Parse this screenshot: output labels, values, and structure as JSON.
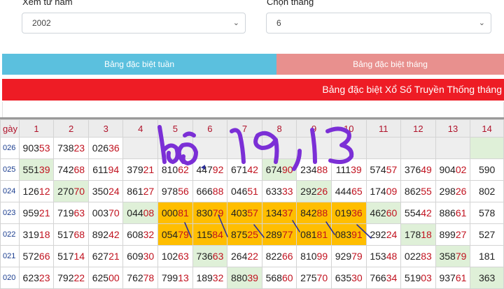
{
  "filters": {
    "year_label": "Xem từ năm",
    "year_value": "2002",
    "month_label": "Chọn tháng",
    "month_value": "6"
  },
  "tabs": {
    "weekly": "Bảng đặc biệt tuần",
    "monthly": "Bảng đặc biệt tháng"
  },
  "banner": "Bảng đặc biệt Xổ Số Truyền Thống tháng",
  "table": {
    "corner": "gày",
    "days": [
      "1",
      "2",
      "3",
      "4",
      "5",
      "6",
      "7",
      "8",
      "9",
      "10",
      "11",
      "12",
      "13",
      "14"
    ],
    "rows": [
      {
        "label": "026",
        "cells": [
          [
            "903",
            "53"
          ],
          [
            "738",
            "23"
          ],
          [
            "026",
            "36"
          ],
          [
            "",
            ""
          ],
          [
            "",
            ""
          ],
          [
            "",
            ""
          ],
          [
            "",
            ""
          ],
          [
            "",
            ""
          ],
          [
            "",
            ""
          ],
          [
            "",
            ""
          ],
          [
            "",
            ""
          ],
          [
            "",
            ""
          ],
          [
            "",
            ""
          ],
          [
            "",
            ""
          ]
        ]
      },
      {
        "label": "025",
        "cells": [
          [
            "551",
            "39"
          ],
          [
            "742",
            "68"
          ],
          [
            "611",
            "94"
          ],
          [
            "379",
            "21"
          ],
          [
            "810",
            "62"
          ],
          [
            "447",
            "92"
          ],
          [
            "671",
            "42"
          ],
          [
            "674",
            "90"
          ],
          [
            "234",
            "88"
          ],
          [
            "111",
            "39"
          ],
          [
            "574",
            "57"
          ],
          [
            "376",
            "49"
          ],
          [
            "904",
            "02"
          ],
          [
            "590",
            ""
          ]
        ]
      },
      {
        "label": "024",
        "cells": [
          [
            "126",
            "12"
          ],
          [
            "270",
            "70"
          ],
          [
            "350",
            "24"
          ],
          [
            "861",
            "27"
          ],
          [
            "978",
            "56"
          ],
          [
            "666",
            "88"
          ],
          [
            "046",
            "51"
          ],
          [
            "633",
            "33"
          ],
          [
            "292",
            "26"
          ],
          [
            "444",
            "65"
          ],
          [
            "174",
            "09"
          ],
          [
            "862",
            "55"
          ],
          [
            "298",
            "26"
          ],
          [
            "802",
            ""
          ]
        ]
      },
      {
        "label": "023",
        "cells": [
          [
            "959",
            "21"
          ],
          [
            "719",
            "63"
          ],
          [
            "003",
            "70"
          ],
          [
            "044",
            "08"
          ],
          [
            "000",
            "81"
          ],
          [
            "830",
            "79"
          ],
          [
            "403",
            "57"
          ],
          [
            "134",
            "37"
          ],
          [
            "842",
            "88"
          ],
          [
            "019",
            "36"
          ],
          [
            "462",
            "60"
          ],
          [
            "554",
            "42"
          ],
          [
            "886",
            "61"
          ],
          [
            "578",
            ""
          ]
        ]
      },
      {
        "label": "022",
        "cells": [
          [
            "319",
            "18"
          ],
          [
            "517",
            "68"
          ],
          [
            "892",
            "42"
          ],
          [
            "608",
            "32"
          ],
          [
            "054",
            "79"
          ],
          [
            "115",
            "84"
          ],
          [
            "875",
            "25"
          ],
          [
            "289",
            "77"
          ],
          [
            "081",
            "81"
          ],
          [
            "083",
            "91"
          ],
          [
            "292",
            "24"
          ],
          [
            "178",
            "18"
          ],
          [
            "899",
            "27"
          ],
          [
            "527",
            ""
          ]
        ]
      },
      {
        "label": "021",
        "cells": [
          [
            "572",
            "66"
          ],
          [
            "517",
            "14"
          ],
          [
            "627",
            "21"
          ],
          [
            "609",
            "30"
          ],
          [
            "102",
            "63"
          ],
          [
            "736",
            "63"
          ],
          [
            "264",
            "22"
          ],
          [
            "822",
            "66"
          ],
          [
            "810",
            "99"
          ],
          [
            "929",
            "79"
          ],
          [
            "153",
            "48"
          ],
          [
            "022",
            "83"
          ],
          [
            "358",
            "79"
          ],
          [
            "181",
            ""
          ]
        ]
      },
      {
        "label": "020",
        "cells": [
          [
            "623",
            "23"
          ],
          [
            "792",
            "22"
          ],
          [
            "625",
            "00"
          ],
          [
            "762",
            "78"
          ],
          [
            "799",
            "13"
          ],
          [
            "189",
            "32"
          ],
          [
            "880",
            "39"
          ],
          [
            "568",
            "60"
          ],
          [
            "275",
            "70"
          ],
          [
            "635",
            "30"
          ],
          [
            "766",
            "34"
          ],
          [
            "519",
            "03"
          ],
          [
            "937",
            "61"
          ],
          [
            "363",
            ""
          ]
        ]
      }
    ]
  },
  "annotation": "lô 19, 13",
  "colors": {
    "tab_weekly": "#5bc0de",
    "tab_monthly": "#e8908e",
    "banner": "#ee1c25",
    "header_text": "#b0132b",
    "highlight_orange": "#ffbe00",
    "highlight_green": "#dff0d8",
    "ink": "#7b2fd6"
  }
}
